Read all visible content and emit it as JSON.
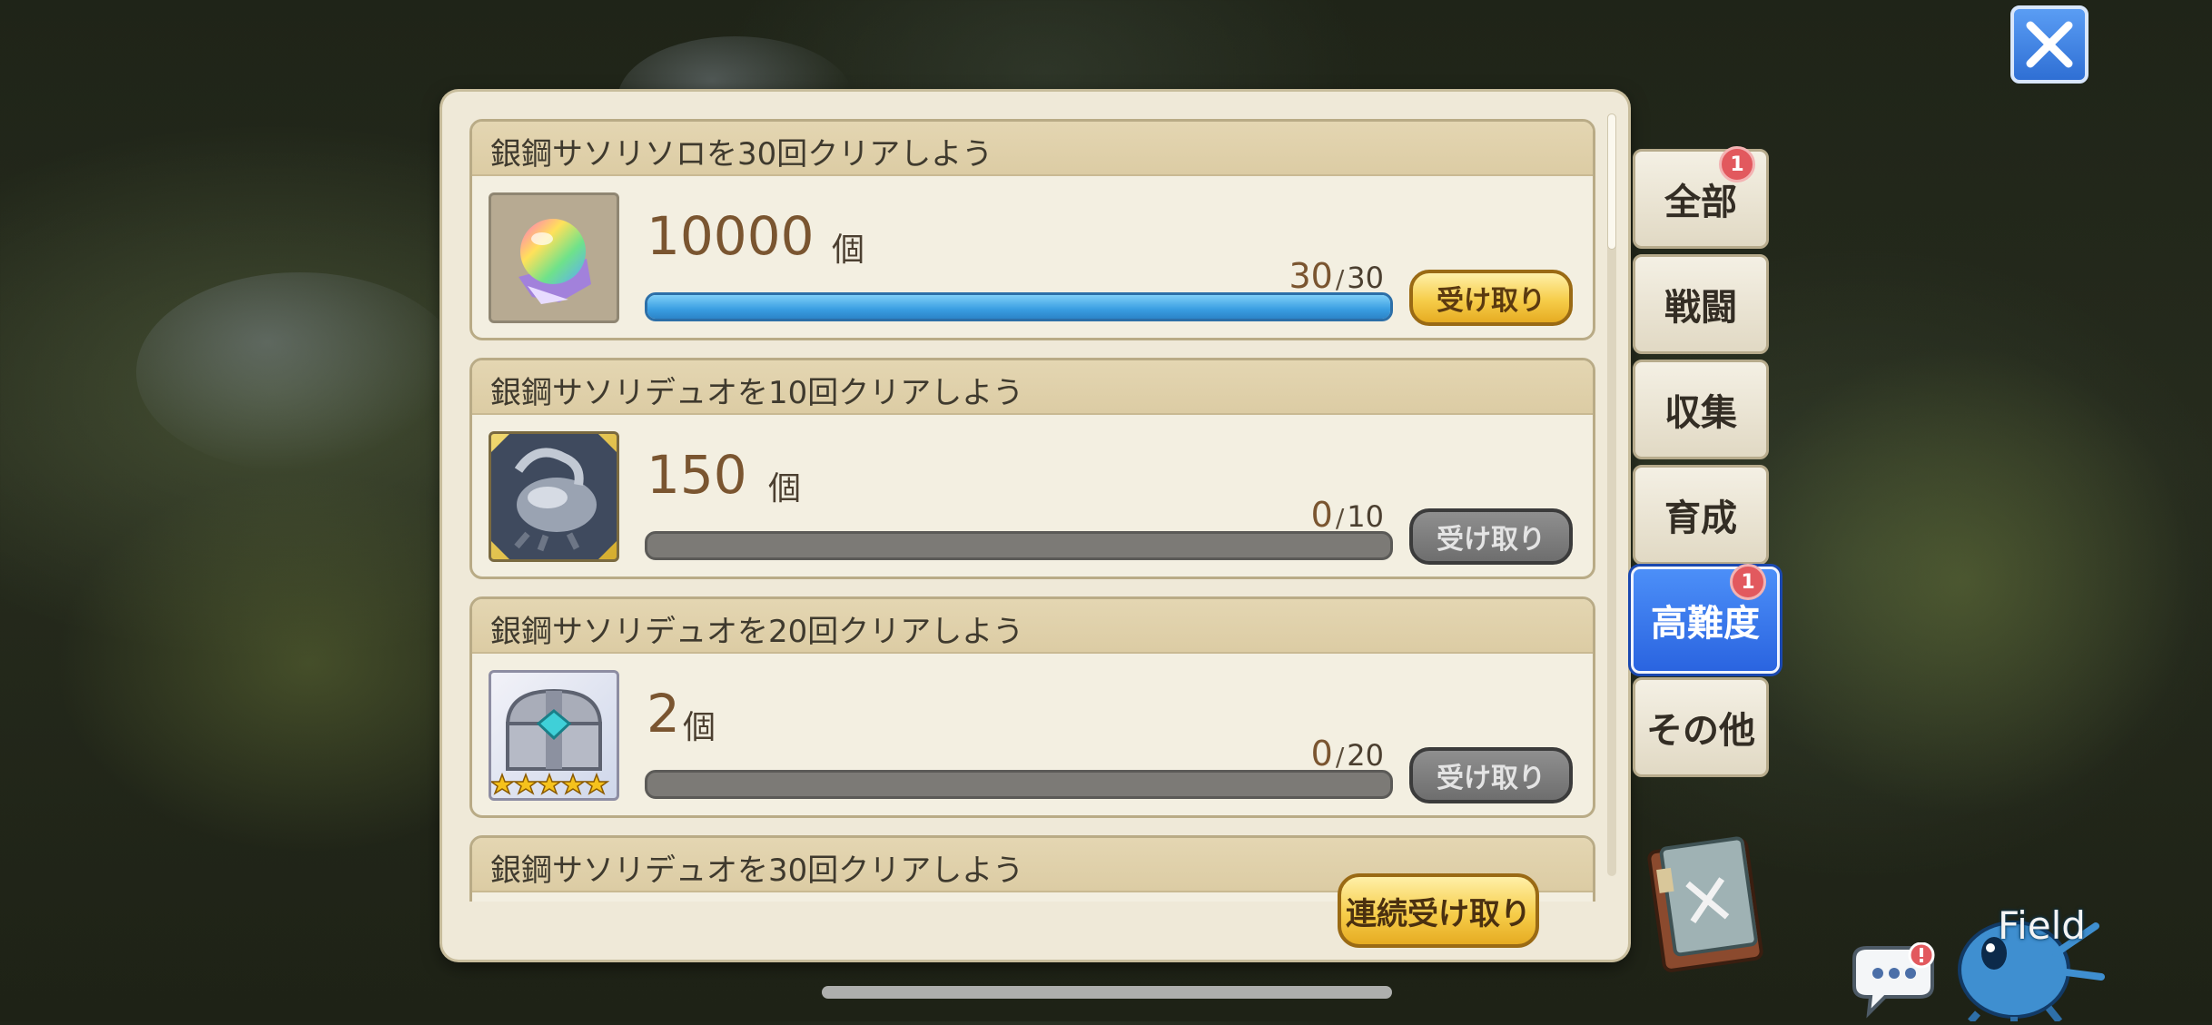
{
  "missions": [
    {
      "title": "銀鋼サソリソロを30回クリアしよう",
      "icon": "rainbow-orb-icon",
      "amount": "10000",
      "unit": "個",
      "current": "30",
      "target": "30",
      "progress": 1.0,
      "claim_label": "受け取り",
      "claimable": true
    },
    {
      "title": "銀鋼サソリデュオを10回クリアしよう",
      "icon": "silver-scorpion-icon",
      "amount": "150",
      "unit": "個",
      "current": "0",
      "target": "10",
      "progress": 0.0,
      "claim_label": "受け取り",
      "claimable": false
    },
    {
      "title": "銀鋼サソリデュオを20回クリアしよう",
      "icon": "treasure-chest-icon",
      "amount": "2",
      "unit": "個",
      "current": "0",
      "target": "20",
      "progress": 0.0,
      "claim_label": "受け取り",
      "claimable": false
    },
    {
      "title": "銀鋼サソリデュオを30回クリアしよう"
    }
  ],
  "progress_separator": "/",
  "claim_all_label": "連続受け取り",
  "tabs": [
    {
      "label": "全部",
      "badge": "1",
      "active": false
    },
    {
      "label": "戦闘",
      "active": false
    },
    {
      "label": "収集",
      "active": false
    },
    {
      "label": "育成",
      "active": false
    },
    {
      "label": "高難度",
      "badge": "1",
      "active": true
    },
    {
      "label": "その他",
      "active": false
    }
  ],
  "chest_rarity_stars": 5,
  "field_label": "Field",
  "colors": {
    "active_tab": "#2a64e0",
    "progress_fill": "#3a9ee2",
    "claim_gold": "#f6cd4a",
    "badge_red": "#e2595e"
  }
}
